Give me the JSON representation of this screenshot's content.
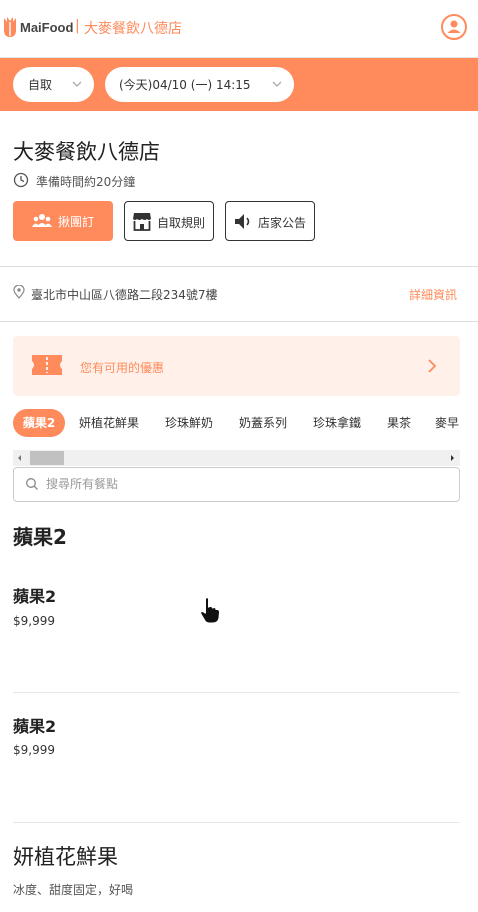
{
  "header": {
    "logo_text": "MaiFood",
    "separator": "|",
    "store_name": "大麥餐飲八德店",
    "brand_color": "#ff8a5b"
  },
  "order_bar": {
    "mode": "自取",
    "pickup_time": "(今天)04/10 (一) 14:15"
  },
  "store": {
    "name": "大麥餐飲八德店",
    "prep_time": "準備時間約20分鐘",
    "buttons": {
      "group_order": "揪團訂",
      "pickup_rules": "自取規則",
      "announcement": "店家公告"
    },
    "address": "臺北市中山區八德路二段234號7樓",
    "details_link": "詳細資訊"
  },
  "coupon": {
    "text": "您有可用的優惠"
  },
  "categories": [
    "蘋果2",
    "妍植花鮮果",
    "珍珠鮮奶",
    "奶蓋系列",
    "珍珠拿鐵",
    "果茶",
    "麥早"
  ],
  "search": {
    "placeholder": "搜尋所有餐點"
  },
  "menu": {
    "section1": {
      "title": "蘋果2",
      "items": [
        {
          "name": "蘋果2",
          "price": "$9,999"
        },
        {
          "name": "蘋果2",
          "price": "$9,999"
        }
      ]
    },
    "section2": {
      "title": "妍植花鮮果",
      "description": "冰度、甜度固定，好喝"
    }
  }
}
